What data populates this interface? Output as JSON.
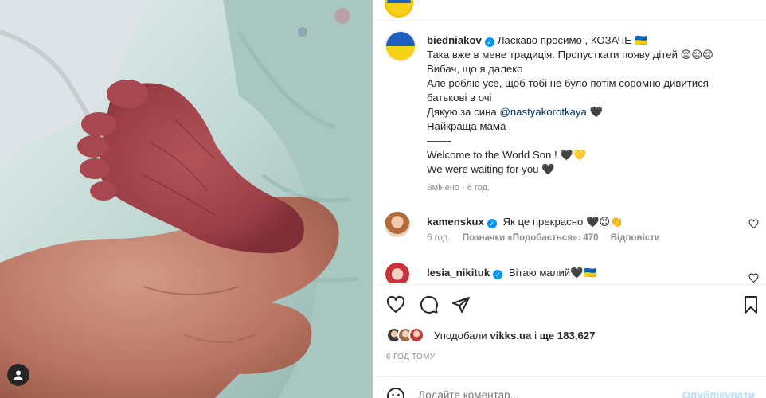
{
  "post": {
    "photo_alt": "",
    "author": {
      "username": "biedniakov"
    },
    "caption_lines": [
      "Ласкаво просимо , КОЗАЧЕ 🇺🇦",
      "Така вже в мене традиція. Пропусткати появу дітей 😔😔😔",
      "Вибач, що я далеко",
      "Але роблю усе, щоб тобі не було потім соромно дивитися",
      "батькові в очі",
      "Дякую за сина",
      "Найкраща мама",
      "——-",
      "Welcome to the World Son ! 🖤💛",
      "We were waiting for you 🖤"
    ],
    "mention": "@nastyakorotkaya",
    "mention_suffix": " 🖤",
    "edited": "Змінено · 6 год.",
    "comments": [
      {
        "username": "kamenskux",
        "text": "Як це прекрасно 🖤😍👏",
        "time": "6 год.",
        "likes": "Позначки «Подобається»: 470",
        "reply": "Відповісти"
      },
      {
        "username": "lesia_nikituk",
        "text": "Вітаю малий🖤🇺🇦"
      }
    ],
    "liked_prefix": "Уподобали ",
    "liked_user": "vikks.ua",
    "liked_mid": " і ",
    "liked_count": "ще 183,627",
    "time_ago": "6 ГОД ТОМУ",
    "add_comment_placeholder": "Додайте коментар...",
    "publish": "Опублікувати"
  },
  "icons": {
    "tag": "user-tag-icon",
    "like": "heart-icon",
    "comment": "comment-icon",
    "share": "share-icon",
    "save": "bookmark-icon",
    "emoji": "emoji-icon"
  },
  "colors": {
    "accent": "#0095f6",
    "mention": "#00376b",
    "muted": "#8e8e8e",
    "publish_disabled": "#b2dffc"
  }
}
